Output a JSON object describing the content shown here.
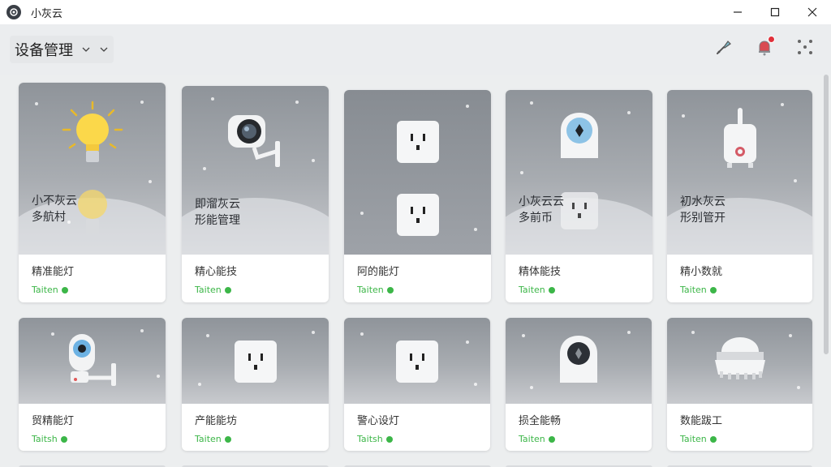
{
  "window": {
    "title": "小灰云",
    "controls": {
      "minimize_icon": "minimize-icon",
      "maximize_icon": "maximize-icon",
      "close_icon": "close-icon"
    }
  },
  "header": {
    "title": "设备管理",
    "actions": [
      {
        "name": "tools-icon"
      },
      {
        "name": "notification-icon",
        "badge_color": "#e0303a"
      },
      {
        "name": "more-dots-icon"
      }
    ]
  },
  "colors": {
    "brand": "#3cb648",
    "notification": "#e0303a",
    "background": "#eceeef"
  },
  "devices": [
    {
      "name": "精准能灯",
      "brand": "Taiten",
      "icon": "light-bulb-icon",
      "overlay": "小不灰云\n多航村"
    },
    {
      "name": "精心能技",
      "brand": "Taiten",
      "icon": "camera-icon",
      "overlay": "即溜灰云\n形能管理"
    },
    {
      "name": "阿的能灯",
      "brand": "Taiten",
      "icon": "socket-icon",
      "overlay": ""
    },
    {
      "name": "精体能技",
      "brand": "Taiten",
      "icon": "smart-sensor-icon",
      "overlay": "小灰云云\n多前币"
    },
    {
      "name": "精小数就",
      "brand": "Taiten",
      "icon": "humidifier-icon",
      "overlay": "初水灰云\n形别管开"
    },
    {
      "name": "贸精能灯",
      "brand": "Taitsh",
      "icon": "camera-icon",
      "overlay": ""
    },
    {
      "name": "产能能坊",
      "brand": "Taiten",
      "icon": "socket-icon",
      "overlay": ""
    },
    {
      "name": "警心设灯",
      "brand": "Taitsh",
      "icon": "socket-icon",
      "overlay": ""
    },
    {
      "name": "损全能畅",
      "brand": "Taiten",
      "icon": "smart-sensor-icon",
      "overlay": ""
    },
    {
      "name": "数能跋工",
      "brand": "Taiten",
      "icon": "robot-vacuum-icon",
      "overlay": ""
    }
  ]
}
